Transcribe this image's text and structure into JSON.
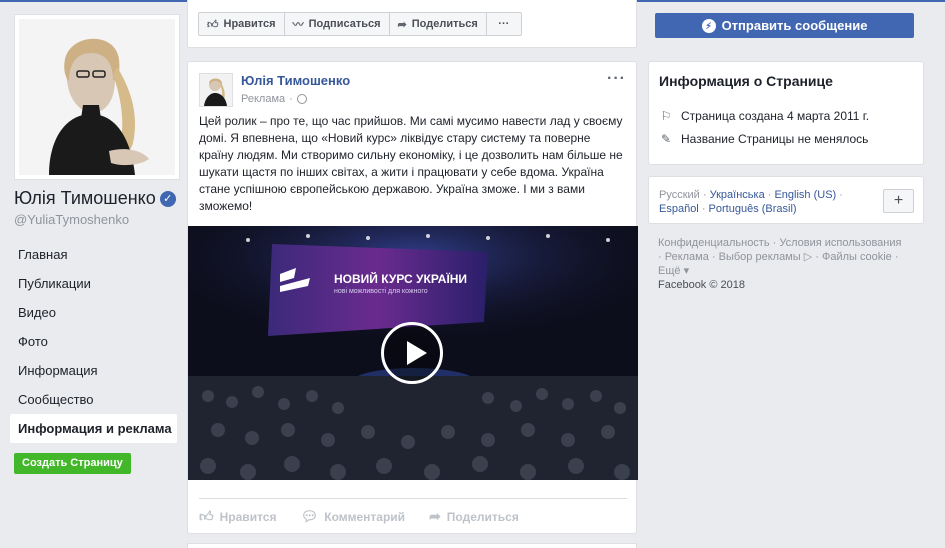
{
  "colors": {
    "brand": "#4267b2",
    "link": "#365899",
    "green": "#42b72a",
    "background": "#e9ebee"
  },
  "profile": {
    "name": "Юлія Тимошенко",
    "handle": "@YuliaTymoshenko",
    "verified_icon": "check-icon"
  },
  "nav": {
    "items": [
      {
        "label": "Главная"
      },
      {
        "label": "Публикации"
      },
      {
        "label": "Видео"
      },
      {
        "label": "Фото"
      },
      {
        "label": "Информация"
      },
      {
        "label": "Сообщество"
      },
      {
        "label": "Информация и реклама"
      }
    ],
    "create_page": "Создать Страницу"
  },
  "actionbar": {
    "like": "Нравится",
    "follow": "Подписаться",
    "share": "Поделиться",
    "more": "···",
    "send_message": "Отправить сообщение"
  },
  "post": {
    "author": "Юлія Тимошенко",
    "sponsored": "Реклама",
    "text": "Цей ролик – про те, що час прийшов. Ми самі мусимо навести лад у своєму домі. Я впевнена, що «Новий курс» ліквідує стару систему та поверне країну людям. Ми створимо сильну економіку, і це дозволить нам більше не шукати щастя по інших світах, а жити і працювати у себе вдома. Україна стане успішною європейською державою. Україна зможе. І ми з вами зможемо!",
    "video": {
      "screen_title": "НОВИЙ КУРС УКРАЇНИ",
      "screen_subtitle": "нові можливості для кожного"
    },
    "actions": {
      "like": "Нравится",
      "comment": "Комментарий",
      "share": "Поделиться"
    }
  },
  "info": {
    "title": "Информация о Странице",
    "created": "Страница создана 4 марта 2011 г.",
    "name_unchanged": "Название Страницы не менялось"
  },
  "languages": {
    "current": "Русский",
    "others": [
      "Українська",
      "English (US)",
      "Español",
      "Português (Brasil)"
    ],
    "plus": "+"
  },
  "footer": {
    "links": [
      "Конфиденциальность",
      "Условия использования",
      "Реклама",
      "Выбор рекламы",
      "Файлы cookie",
      "Ещё"
    ],
    "copyright": "Facebook © 2018"
  }
}
